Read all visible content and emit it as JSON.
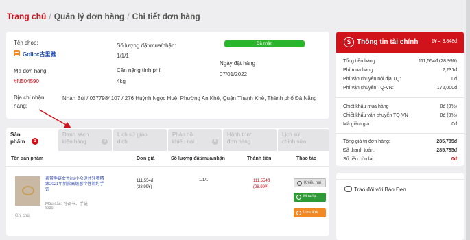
{
  "breadcrumb": {
    "home": "Trang chủ",
    "sep": "/",
    "orders": "Quản lý đơn hàng",
    "current": "Chi tiết đơn hàng"
  },
  "order": {
    "shop_label": "Tên shop:",
    "shop_name": "Golicc古里雅",
    "qty_label": "Số lượng đặt/mua/nhận:",
    "qty_value": "1/1/1",
    "status": "Đã nhận",
    "date_label": "Ngày đặt hàng",
    "date_value": "07/01/2022",
    "code_label": "Mã đơn hàng",
    "code_value": "#N504590",
    "weight_label": "Cân nặng tính phí",
    "weight_value": "4kg",
    "addr_label_1": "Địa chỉ nhận",
    "addr_label_2": "hàng:",
    "addr_value": "Nhàn Bùi / 0377984107 / 276 Huỳnh Ngọc Huệ, Phường An Khê, Quận Thanh Khê, Thành phố Đà Nẵng"
  },
  "tabs": [
    {
      "l1": "Sản",
      "l2": "phẩm",
      "badge": "1"
    },
    {
      "l1": "Danh sách",
      "l2": "kiện hàng",
      "badge": "0"
    },
    {
      "l1": "Lịch sử giao",
      "l2": "dịch",
      "badge": ""
    },
    {
      "l1": "Phản hồi",
      "l2": "khiếu nại",
      "badge": "0"
    },
    {
      "l1": "Hành trình",
      "l2": "đơn hàng",
      "badge": ""
    },
    {
      "l1": "Lịch sử",
      "l2": "chỉnh sửa",
      "badge": ""
    }
  ],
  "table": {
    "headers": [
      "Tên sản phẩm",
      "Đơn giá",
      "Số lượng đặt/mua/nhận",
      "Thành tiền",
      "Thao tác"
    ],
    "row": {
      "name_1": "表带手链女生ins小众设计轻奢精",
      "name_2": "致2021年新款高级感个性简约手",
      "name_3": "饰",
      "color": "Màu sắc: 可调节、手链",
      "size": "Size:",
      "note": "Ghi chú:",
      "price": "111,554đ",
      "price_cny": "(28.99¥)",
      "qty": "1/1/1",
      "total": "111,554đ",
      "total_cny": "(28.99¥)",
      "btn_complain": "Khiếu nại",
      "btn_rebuy": "Mua lại",
      "btn_save": "Lưu link"
    }
  },
  "finance": {
    "title": "Thông tin tài chính",
    "rate": "1¥ = 3,848đ",
    "group1": [
      {
        "label": "Tổng tiền hàng:",
        "value": "111,554đ (28.99¥)"
      },
      {
        "label": "Phí mua hàng:",
        "value": "2,231đ"
      },
      {
        "label": "Phí vận chuyển nội địa TQ:",
        "value": "0đ"
      },
      {
        "label": "Phí vận chuyển TQ-VN:",
        "value": "172,000đ"
      }
    ],
    "group2": [
      {
        "label": "Chiết khấu mua hàng",
        "value": "0đ (0%)"
      },
      {
        "label": "Chiết khấu vận chuyển TQ-VN",
        "value": "0đ (0%)"
      },
      {
        "label": "Mã giảm giá",
        "value": "0đ"
      }
    ],
    "group3": [
      {
        "label": "Tổng giá trị đơn hàng:",
        "value": "285,785đ"
      },
      {
        "label": "Đã thanh toán:",
        "value": "285,785đ"
      },
      {
        "label": "Số tiền còn lại:",
        "value": "0đ"
      }
    ]
  },
  "chat": {
    "title": "Trao đổi với Báo Đen"
  },
  "colors": {
    "brand_red": "#d0121a",
    "status_green": "#2cb52c",
    "link_blue": "#1e4cb5"
  }
}
